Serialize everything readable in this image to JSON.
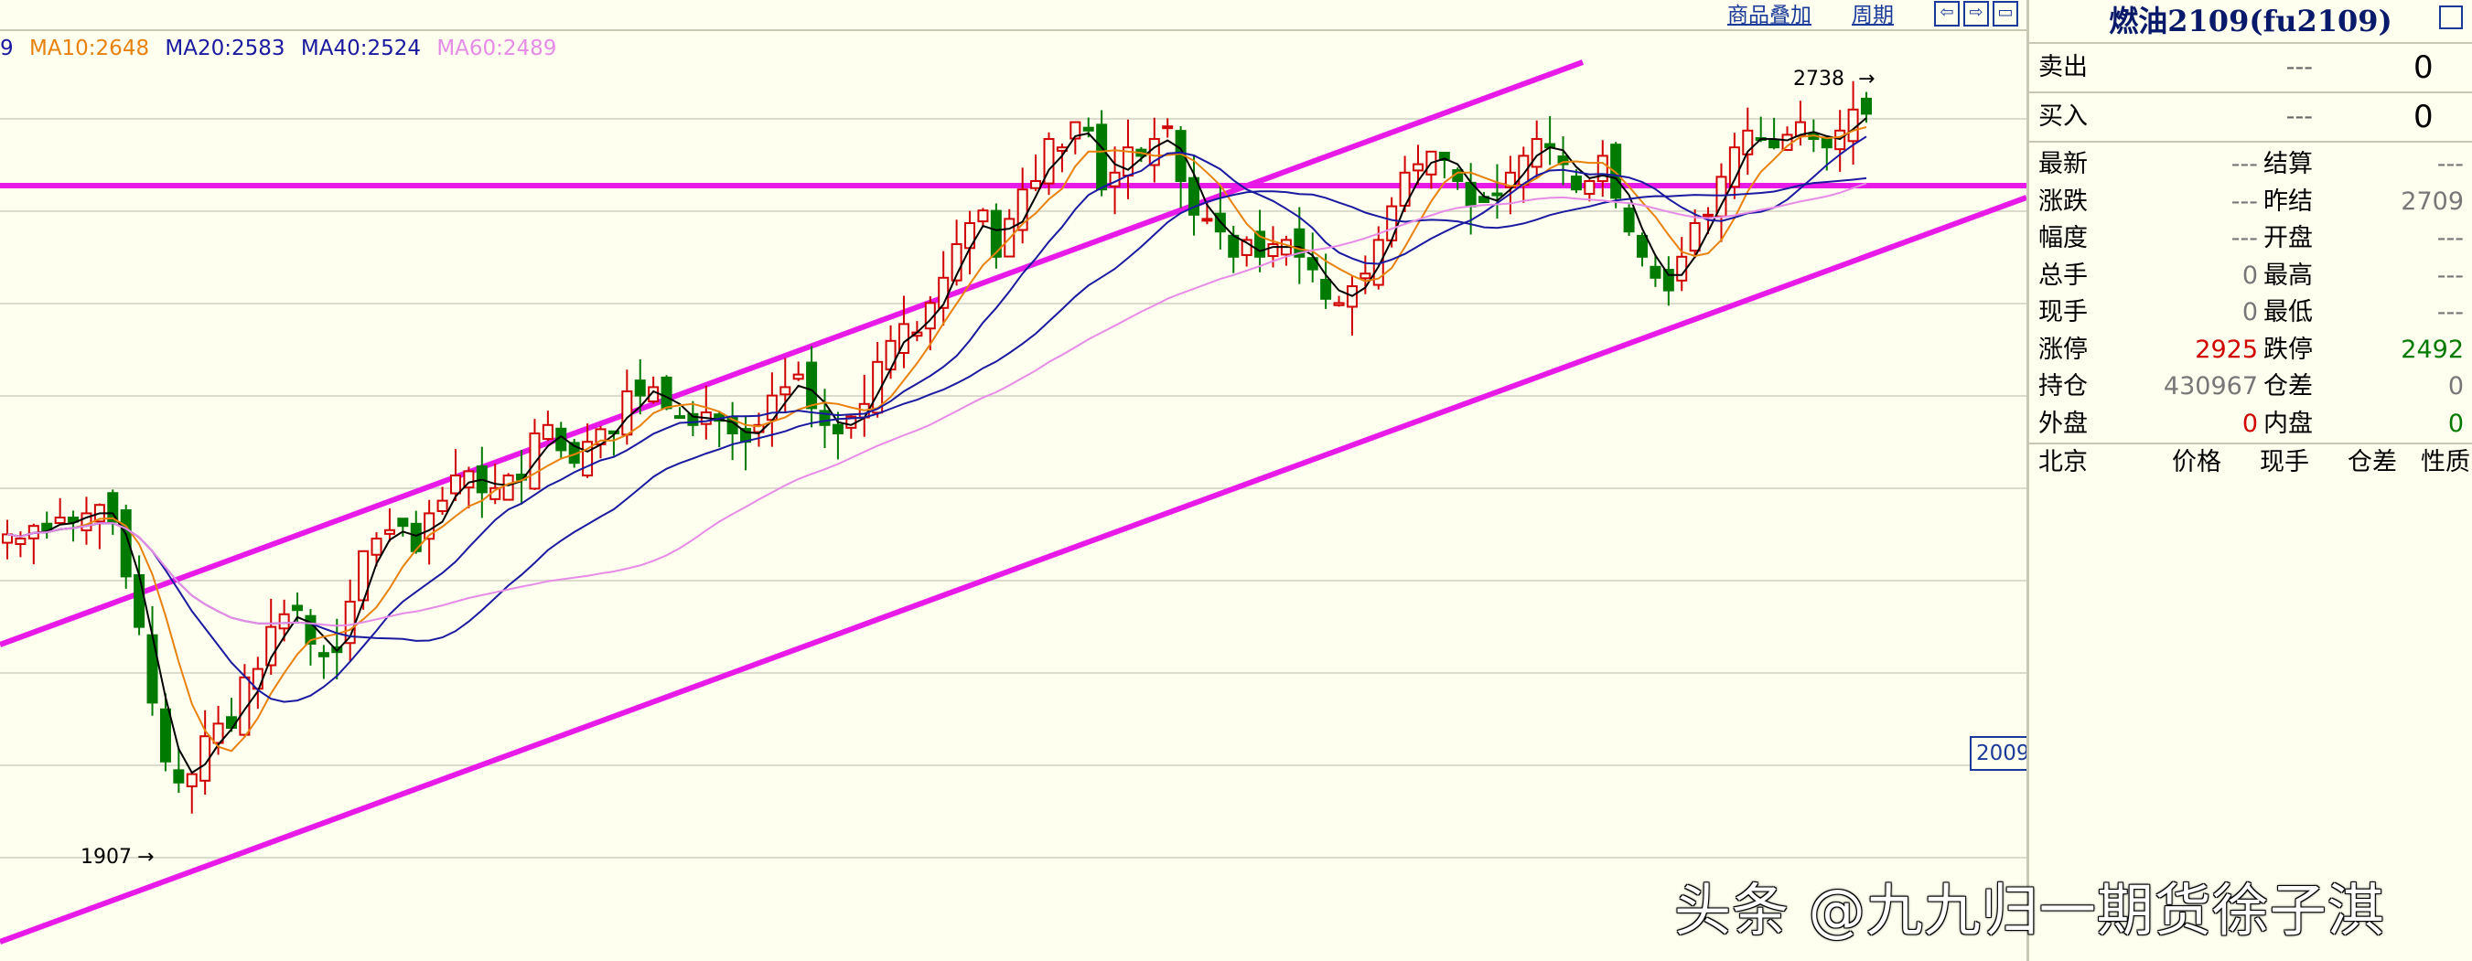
{
  "toolbar": {
    "overlay_label": "商品叠加",
    "period_label": "周期",
    "nav_icons": [
      "arrow-left-icon",
      "arrow-right-icon",
      "window-icon"
    ]
  },
  "ma_legend": {
    "first_fragment": "9",
    "items": [
      {
        "label": "MA10:2648",
        "color": "#e8820c"
      },
      {
        "label": "MA20:2583",
        "color": "#1a1aa0"
      },
      {
        "label": "MA40:2524",
        "color": "#1a1aa0"
      },
      {
        "label": "MA60:2489",
        "color": "#e68ce6"
      }
    ]
  },
  "chart_annotations": {
    "high_label": "2738",
    "low_label": "1907",
    "year_tag": "2009"
  },
  "chart_data": {
    "type": "candlestick",
    "title": "",
    "y_range": [
      1800,
      2800
    ],
    "series_colors": {
      "up": "#d00000",
      "down": "#007a00",
      "ma5": "#000000",
      "ma10": "#e8820c",
      "ma20": "#1a1aa0",
      "ma40": "#1a1aa0",
      "ma60": "#e68ce6",
      "trendline": "#e81ae8"
    },
    "close_prices": [
      2230,
      2225,
      2240,
      2235,
      2250,
      2245,
      2255,
      2265,
      2245,
      2180,
      2120,
      2030,
      1960,
      1935,
      1945,
      1990,
      2005,
      2000,
      2060,
      2070,
      2120,
      2135,
      2140,
      2100,
      2085,
      2090,
      2150,
      2210,
      2225,
      2235,
      2240,
      2210,
      2255,
      2270,
      2300,
      2305,
      2280,
      2285,
      2300,
      2295,
      2350,
      2360,
      2330,
      2315,
      2340,
      2355,
      2350,
      2400,
      2395,
      2405,
      2380,
      2370,
      2360,
      2375,
      2365,
      2350,
      2340,
      2360,
      2395,
      2405,
      2420,
      2380,
      2360,
      2350,
      2370,
      2385,
      2435,
      2460,
      2480,
      2470,
      2505,
      2535,
      2575,
      2600,
      2615,
      2560,
      2605,
      2640,
      2650,
      2700,
      2690,
      2720,
      2710,
      2640,
      2660,
      2690,
      2680,
      2700,
      2715,
      2650,
      2610,
      2605,
      2590,
      2560,
      2580,
      2560,
      2575,
      2580,
      2560,
      2545,
      2510,
      2505,
      2525,
      2540,
      2580,
      2620,
      2660,
      2670,
      2685,
      2675,
      2650,
      2620,
      2625,
      2635,
      2660,
      2680,
      2700,
      2690,
      2670,
      2640,
      2650,
      2680,
      2630,
      2590,
      2560,
      2535,
      2520,
      2560,
      2600,
      2610,
      2655,
      2690,
      2710,
      2700,
      2690,
      2705,
      2720,
      2700,
      2690,
      2710,
      2735,
      2730
    ],
    "max_high": 2738,
    "min_low": 1907
  },
  "sidebar": {
    "title": "燃油2109(fu2109)",
    "sell": {
      "label": "卖出",
      "price": "---",
      "volume": "0"
    },
    "buy": {
      "label": "买入",
      "price": "---",
      "volume": "0"
    },
    "quote_rows": [
      {
        "l1": "最新",
        "v1": "---",
        "v1_color": "grey",
        "l2": "结算",
        "v2": "---",
        "v2_color": "grey"
      },
      {
        "l1": "涨跌",
        "v1": "---",
        "v1_color": "grey",
        "l2": "昨结",
        "v2": "2709",
        "v2_color": "grey"
      },
      {
        "l1": "幅度",
        "v1": "---",
        "v1_color": "grey",
        "l2": "开盘",
        "v2": "---",
        "v2_color": "grey"
      },
      {
        "l1": "总手",
        "v1": "0",
        "v1_color": "grey",
        "l2": "最高",
        "v2": "---",
        "v2_color": "grey"
      },
      {
        "l1": "现手",
        "v1": "0",
        "v1_color": "grey",
        "l2": "最低",
        "v2": "---",
        "v2_color": "grey"
      },
      {
        "l1": "涨停",
        "v1": "2925",
        "v1_color": "red",
        "l2": "跌停",
        "v2": "2492",
        "v2_color": "green"
      },
      {
        "l1": "持仓",
        "v1": "430967",
        "v1_color": "grey",
        "l2": "仓差",
        "v2": "0",
        "v2_color": "grey"
      },
      {
        "l1": "外盘",
        "v1": "0",
        "v1_color": "red",
        "l2": "内盘",
        "v2": "0",
        "v2_color": "green"
      }
    ],
    "trade_header": {
      "col1": "北京",
      "col2": "价格",
      "col3": "现手",
      "col4": "仓差",
      "col5": "性质"
    }
  },
  "watermark": "头条 @九九归一期货徐子淇"
}
